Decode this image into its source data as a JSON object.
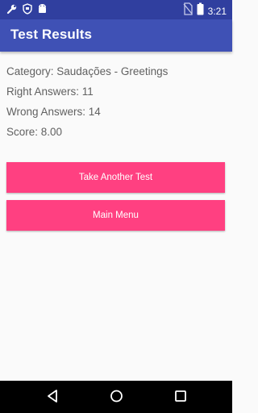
{
  "status_bar": {
    "time": "3:21",
    "icons": [
      "wrench-icon",
      "shield-icon",
      "android-icon",
      "no-sim-icon",
      "battery-icon"
    ]
  },
  "app_bar": {
    "title": "Test Results"
  },
  "results": {
    "category": "Category: Saudações - Greetings",
    "right_answers": "Right Answers: 11",
    "wrong_answers": "Wrong Answers: 14",
    "score": "Score: 8.00"
  },
  "buttons": {
    "take_another_test": "Take Another Test",
    "main_menu": "Main Menu"
  },
  "nav_bar": {
    "icons": [
      "back-icon",
      "home-icon",
      "recents-icon"
    ]
  },
  "colors": {
    "status_bar": "#303f9f",
    "app_bar": "#3f51b5",
    "accent": "#ff4081",
    "background": "#fafafa"
  }
}
